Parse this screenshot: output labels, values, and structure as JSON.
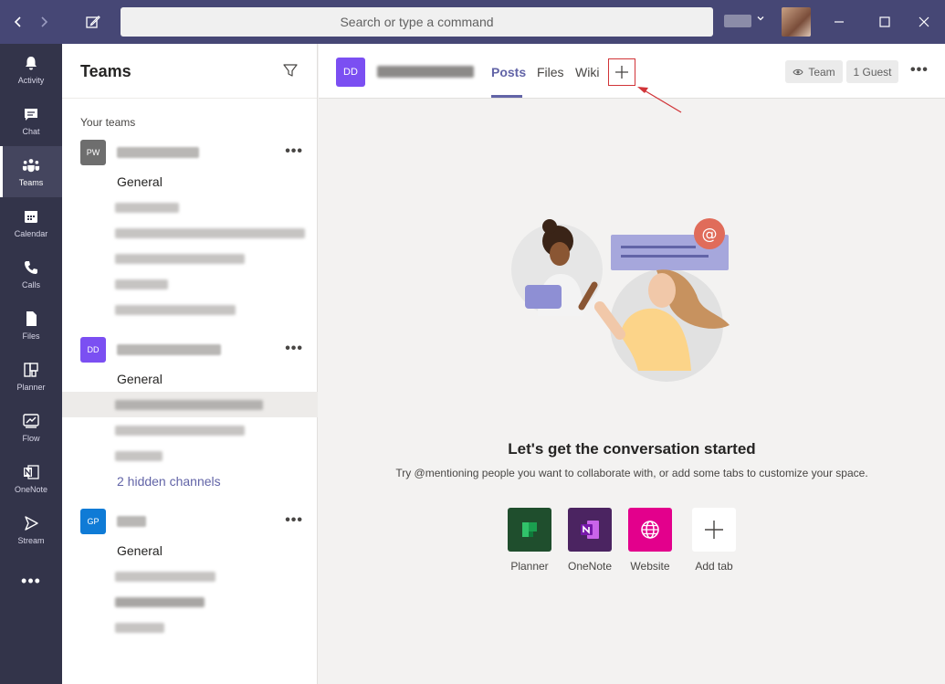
{
  "titlebar": {
    "back_icon": "chevron-left-icon",
    "forward_icon": "chevron-right-icon",
    "compose_icon": "new-chat-icon",
    "search_placeholder": "Search or type a command"
  },
  "appbar": {
    "items": [
      {
        "label": "Activity",
        "icon": "bell-icon"
      },
      {
        "label": "Chat",
        "icon": "chat-icon"
      },
      {
        "label": "Teams",
        "icon": "teams-icon",
        "active": true
      },
      {
        "label": "Calendar",
        "icon": "calendar-icon"
      },
      {
        "label": "Calls",
        "icon": "phone-icon"
      },
      {
        "label": "Files",
        "icon": "file-icon"
      },
      {
        "label": "Planner",
        "icon": "planner-icon"
      },
      {
        "label": "Flow",
        "icon": "flow-icon"
      },
      {
        "label": "OneNote",
        "icon": "onenote-icon"
      },
      {
        "label": "Stream",
        "icon": "stream-icon"
      }
    ],
    "more_label": "•••"
  },
  "panel": {
    "title": "Teams",
    "section_label": "Your teams",
    "teams": [
      {
        "initials": "PW",
        "color": "#6e6e6e",
        "channels": [
          "General"
        ]
      },
      {
        "initials": "DD",
        "color": "#7b4ff2",
        "channels": [
          "General"
        ],
        "hidden_channels": "2 hidden channels"
      },
      {
        "initials": "GP",
        "color": "#0f7bd6",
        "channels": [
          "General"
        ]
      }
    ],
    "more_label": "•••"
  },
  "main": {
    "team_initials": "DD",
    "tabs": [
      "Posts",
      "Files",
      "Wiki"
    ],
    "add_tab_symbol": "+",
    "team_pill": "Team",
    "guest_pill": "1 Guest",
    "more_label": "•••",
    "empty_title": "Let's get the conversation started",
    "empty_subtitle": "Try @mentioning people you want to collaborate with, or add some tabs to customize your space.",
    "apps": [
      {
        "label": "Planner",
        "color": "#1f4e2d"
      },
      {
        "label": "OneNote",
        "color": "#4b2461"
      },
      {
        "label": "Website",
        "color": "#e3008c"
      },
      {
        "label": "Add tab",
        "color": "#ffffff"
      }
    ]
  },
  "colors": {
    "titlebar": "#464775",
    "appbar": "#33344a",
    "accent": "#6264a7",
    "annotation_red": "#d13438"
  }
}
